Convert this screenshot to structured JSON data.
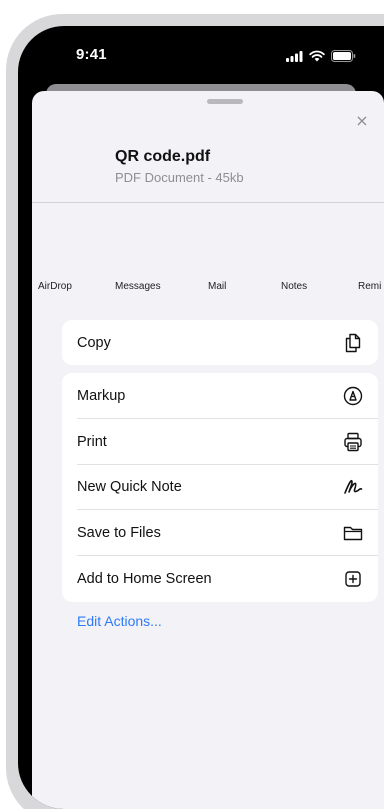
{
  "status_bar": {
    "time": "9:41",
    "icons": [
      "signal-icon",
      "wifi-icon",
      "battery-icon"
    ]
  },
  "share_sheet": {
    "file_name": "QR code.pdf",
    "file_info": "PDF Document - 45kb",
    "close_symbol": "×",
    "apps": [
      "AirDrop",
      "Messages",
      "Mail",
      "Notes",
      "Remi"
    ],
    "copy_group": [
      {
        "label": "Copy",
        "icon": "copy-icon"
      }
    ],
    "actions": [
      {
        "label": "Markup",
        "icon": "markup-icon"
      },
      {
        "label": "Print",
        "icon": "print-icon"
      },
      {
        "label": "New Quick Note",
        "icon": "quick-note-icon"
      },
      {
        "label": "Save to Files",
        "icon": "folder-icon"
      },
      {
        "label": "Add to Home Screen",
        "icon": "add-square-icon"
      }
    ],
    "edit_actions": "Edit Actions..."
  },
  "colors": {
    "accent": "#2f7bf6",
    "sheet_background": "#f2f2f7",
    "secondary_text": "#8e8e93"
  }
}
